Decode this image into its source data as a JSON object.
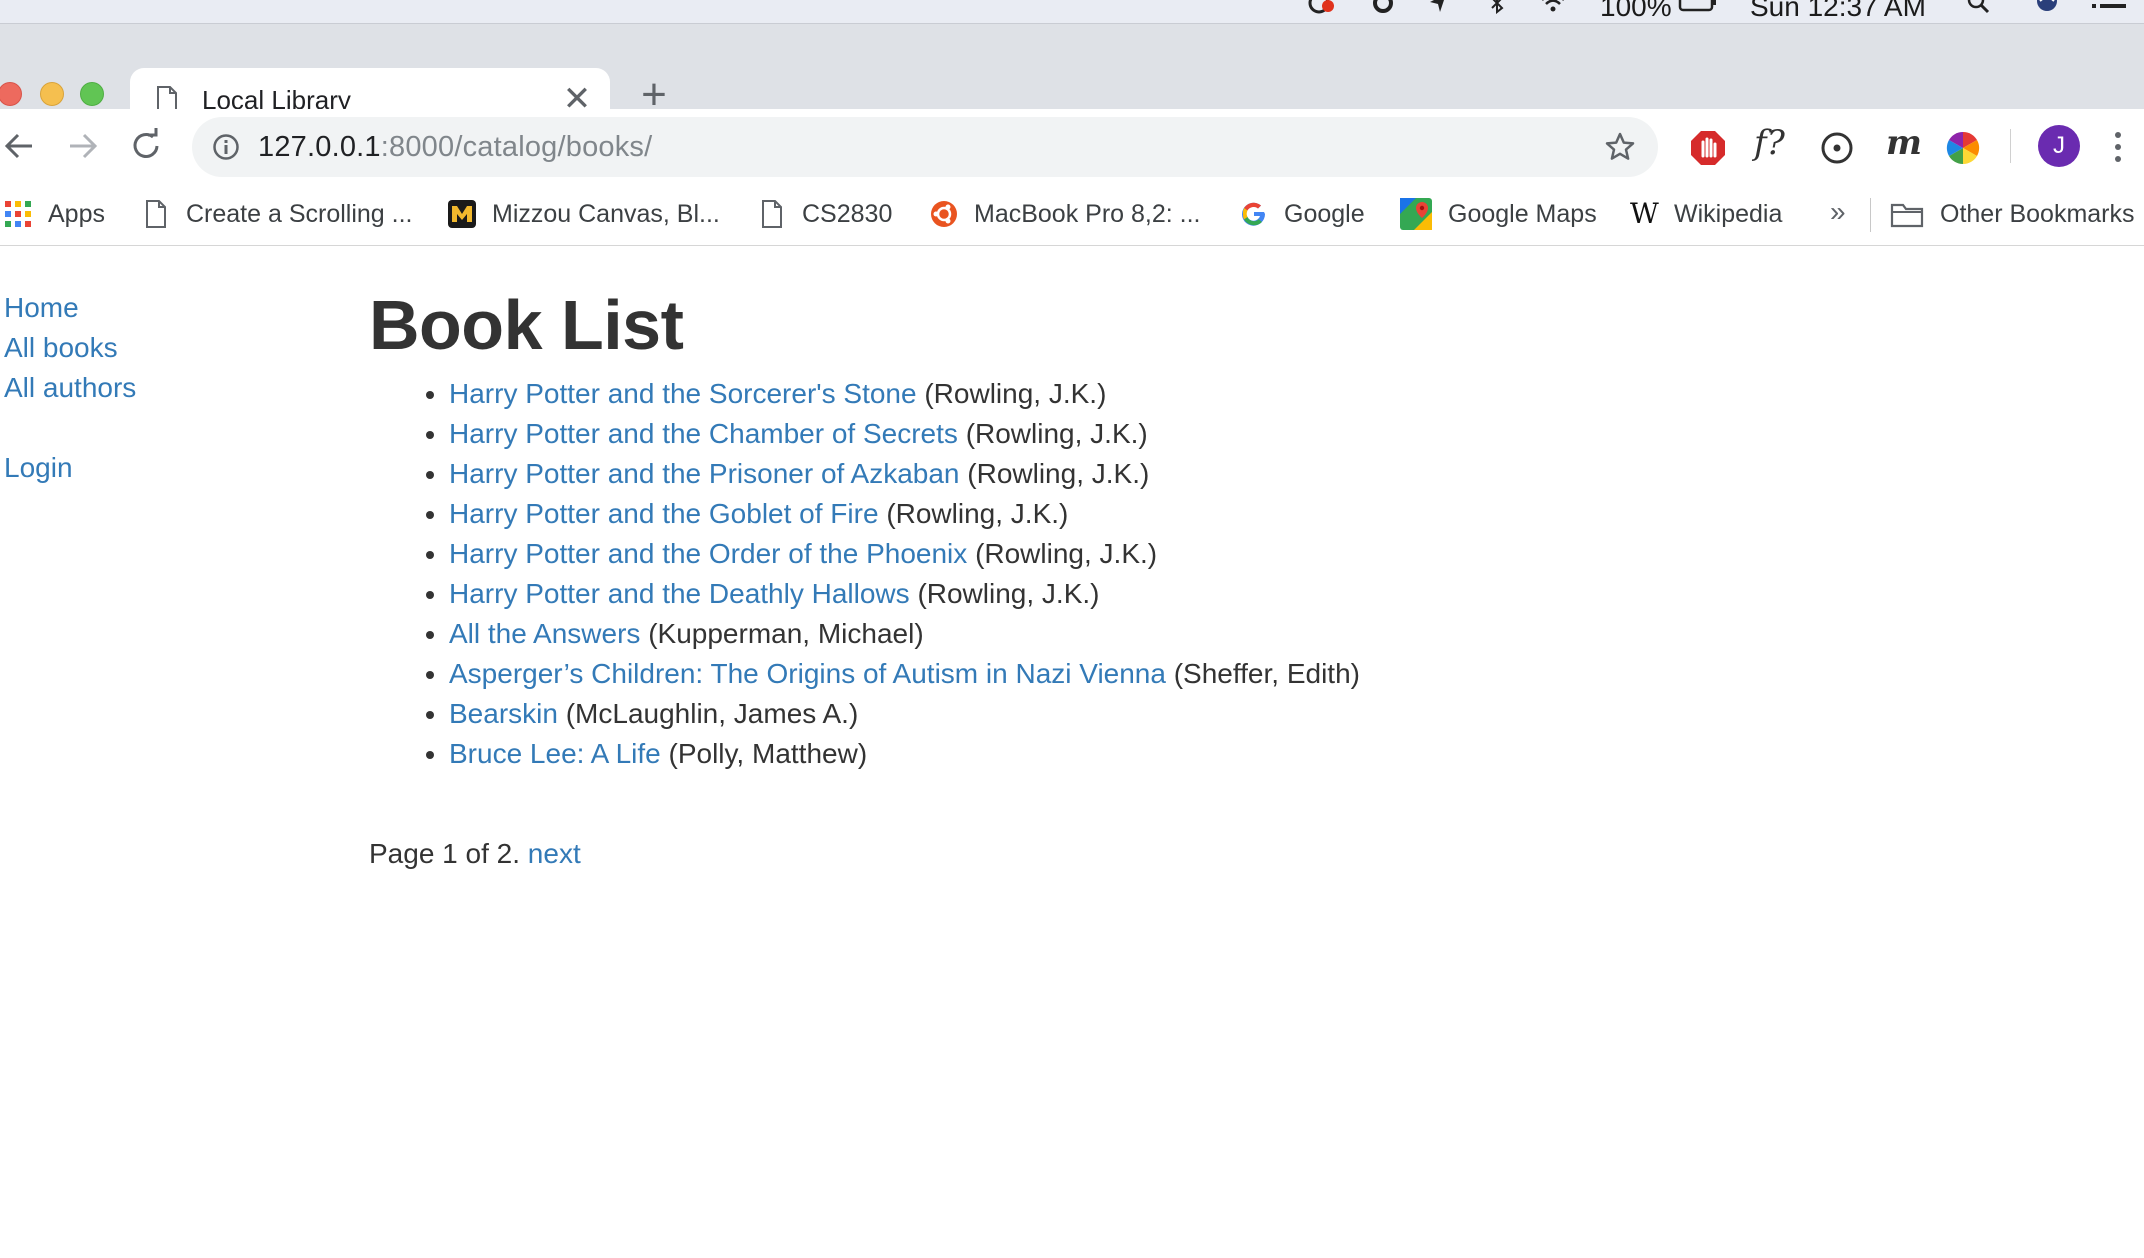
{
  "menubar": {
    "battery": "100%",
    "clock": "Sun 12:37 AM"
  },
  "tab": {
    "title": "Local Library",
    "close_glyph": "✕",
    "new_tab_glyph": "+"
  },
  "toolbar": {
    "url_host": "127.0.0.1",
    "url_rest": ":8000/catalog/books/",
    "profile_initial": "J",
    "ext_fx_label": "f?",
    "ext_m_label": "m"
  },
  "bookmarks": {
    "items": [
      {
        "label": "Apps",
        "icon": "apps-grid-icon"
      },
      {
        "label": "Create a Scrolling ...",
        "icon": "page-icon"
      },
      {
        "label": "Mizzou Canvas, Bl...",
        "icon": "mizzou-logo-icon"
      },
      {
        "label": "CS2830",
        "icon": "page-icon"
      },
      {
        "label": "MacBook Pro 8,2: ...",
        "icon": "ubuntu-icon"
      },
      {
        "label": "Google",
        "icon": "google-icon"
      },
      {
        "label": "Google Maps",
        "icon": "google-maps-icon"
      },
      {
        "label": "Wikipedia",
        "icon": "wikipedia-icon"
      }
    ],
    "more": "»",
    "other": "Other Bookmarks"
  },
  "sidebar": {
    "home": "Home",
    "all_books": "All books",
    "all_authors": "All authors",
    "login": "Login"
  },
  "main": {
    "heading": "Book List",
    "books": [
      {
        "title": "Harry Potter and the Sorcerer's Stone",
        "author": "(Rowling, J.K.)"
      },
      {
        "title": "Harry Potter and the Chamber of Secrets",
        "author": "(Rowling, J.K.)"
      },
      {
        "title": "Harry Potter and the Prisoner of Azkaban",
        "author": "(Rowling, J.K.)"
      },
      {
        "title": "Harry Potter and the Goblet of Fire",
        "author": "(Rowling, J.K.)"
      },
      {
        "title": "Harry Potter and the Order of the Phoenix",
        "author": "(Rowling, J.K.)"
      },
      {
        "title": "Harry Potter and the Deathly Hallows",
        "author": "(Rowling, J.K.)"
      },
      {
        "title": "All the Answers",
        "author": "(Kupperman, Michael)"
      },
      {
        "title": "Asperger’s Children: The Origins of Autism in Nazi Vienna",
        "author": "(Sheffer, Edith)"
      },
      {
        "title": "Bearskin",
        "author": "(McLaughlin, James A.)"
      },
      {
        "title": "Bruce Lee: A Life",
        "author": "(Polly, Matthew)"
      }
    ],
    "pagination": {
      "text": "Page 1 of 2.",
      "next": "next"
    }
  },
  "colors": {
    "link": "#337ab7",
    "text": "#333333",
    "tabstrip": "#dee1e6",
    "avatar": "#6a2bb0"
  }
}
